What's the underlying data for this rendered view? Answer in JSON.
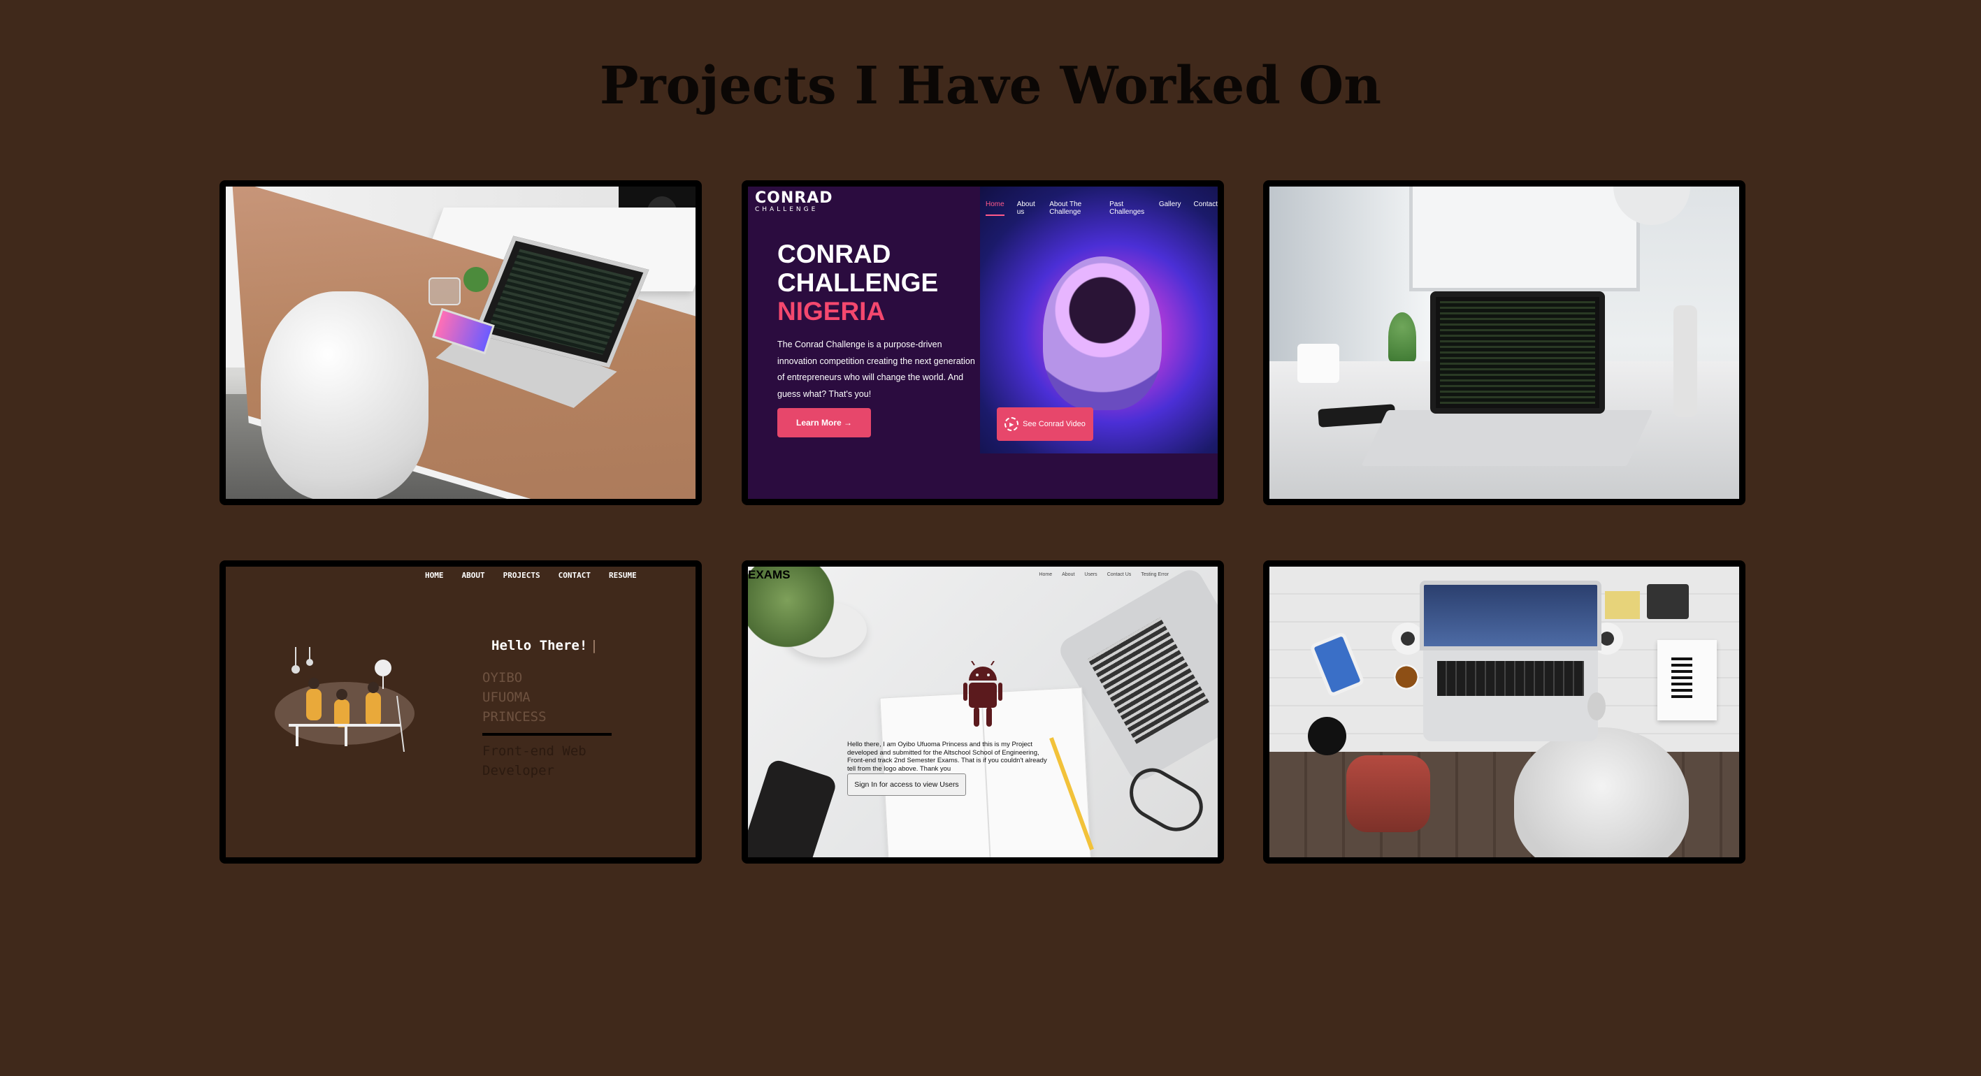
{
  "page": {
    "title": "Projects I Have Worked On",
    "background": "#40291b"
  },
  "projects": [
    {
      "id": "desk-chair-photo"
    },
    {
      "id": "conrad-challenge",
      "logo_main": "CONRAD",
      "logo_sub": "CHALLENGE",
      "nav": [
        "Home",
        "About us",
        "About The Challenge",
        "Past Challenges",
        "Gallery",
        "Contact"
      ],
      "heading_line1": "CONRAD",
      "heading_line2": "CHALLENGE",
      "heading_line3": "NIGERIA",
      "description": "The Conrad Challenge is a purpose-driven innovation competition creating the next generation of entrepreneurs who will change the world. And guess what? That's you!",
      "learn_more": "Learn More →",
      "video_button": "See Conrad Video",
      "accent": "#e7476b"
    },
    {
      "id": "laptop-desk-photo"
    },
    {
      "id": "portfolio",
      "nav": [
        "HOME",
        "ABOUT",
        "PROJECTS",
        "CONTACT",
        "RESUME"
      ],
      "greeting": "Hello There!",
      "name_lines": [
        "OYIBO",
        "UFUOMA",
        "PRINCESS"
      ],
      "role_lines": [
        "Front-end Web",
        "Developer"
      ]
    },
    {
      "id": "exams",
      "brand": "EXAMS",
      "nav": [
        "Home",
        "About",
        "Users",
        "Contact Us",
        "Testing Error"
      ],
      "description": "Hello there, I am Oyibo Ufuoma Princess and this is my Project developed and submitted for the Altschool School of Engineering, Front-end track 2nd Semester Exams. That is if you couldn't already tell from the logo above. Thank you",
      "button": "Sign In for access to view Users",
      "android_color": "#5b1a1d"
    },
    {
      "id": "topdown-desk-photo"
    }
  ]
}
